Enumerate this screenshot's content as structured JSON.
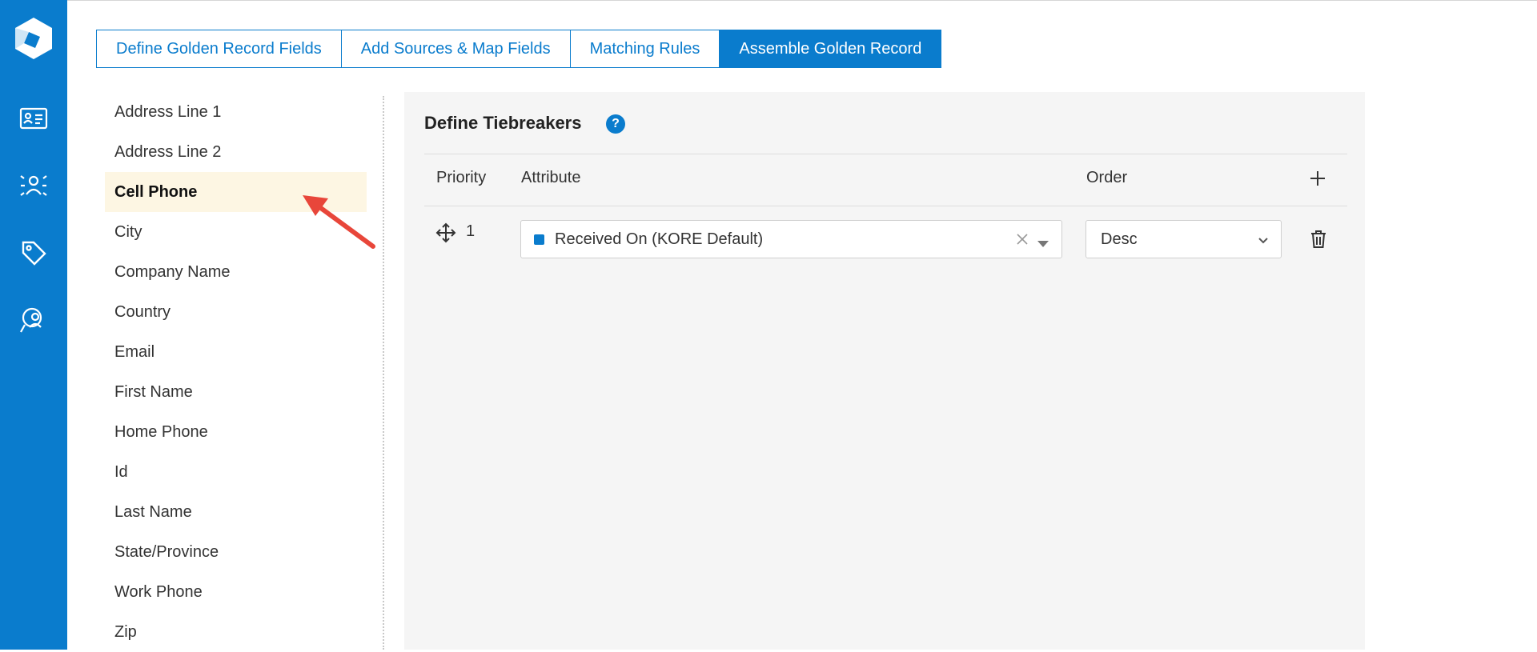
{
  "sidebar": {
    "icons": [
      "logo-icon",
      "contact-card-icon",
      "people-network-icon",
      "tag-icon",
      "user-search-icon"
    ]
  },
  "tabs": [
    {
      "label": "Define Golden Record Fields",
      "active": false
    },
    {
      "label": "Add Sources & Map Fields",
      "active": false
    },
    {
      "label": "Matching Rules",
      "active": false
    },
    {
      "label": "Assemble Golden Record",
      "active": true
    }
  ],
  "fields": {
    "items": [
      {
        "label": "Address Line 1"
      },
      {
        "label": "Address Line 2"
      },
      {
        "label": "Cell Phone",
        "selected": true
      },
      {
        "label": "City"
      },
      {
        "label": "Company Name"
      },
      {
        "label": "Country"
      },
      {
        "label": "Email"
      },
      {
        "label": "First Name"
      },
      {
        "label": "Home Phone"
      },
      {
        "label": "Id"
      },
      {
        "label": "Last Name"
      },
      {
        "label": "State/Province"
      },
      {
        "label": "Work Phone"
      },
      {
        "label": "Zip"
      }
    ]
  },
  "tiebreakers": {
    "title": "Define Tiebreakers",
    "help_icon": "?",
    "columns": {
      "priority": "Priority",
      "attribute": "Attribute",
      "order": "Order"
    },
    "rows": [
      {
        "priority": "1",
        "attribute": "Received On (KORE Default)",
        "order": "Desc"
      }
    ]
  },
  "colors": {
    "accent": "#0a7ccd",
    "selected_row": "#fdf6e3",
    "panel_bg": "#f5f5f5",
    "annotation_arrow": "#e8463a"
  }
}
